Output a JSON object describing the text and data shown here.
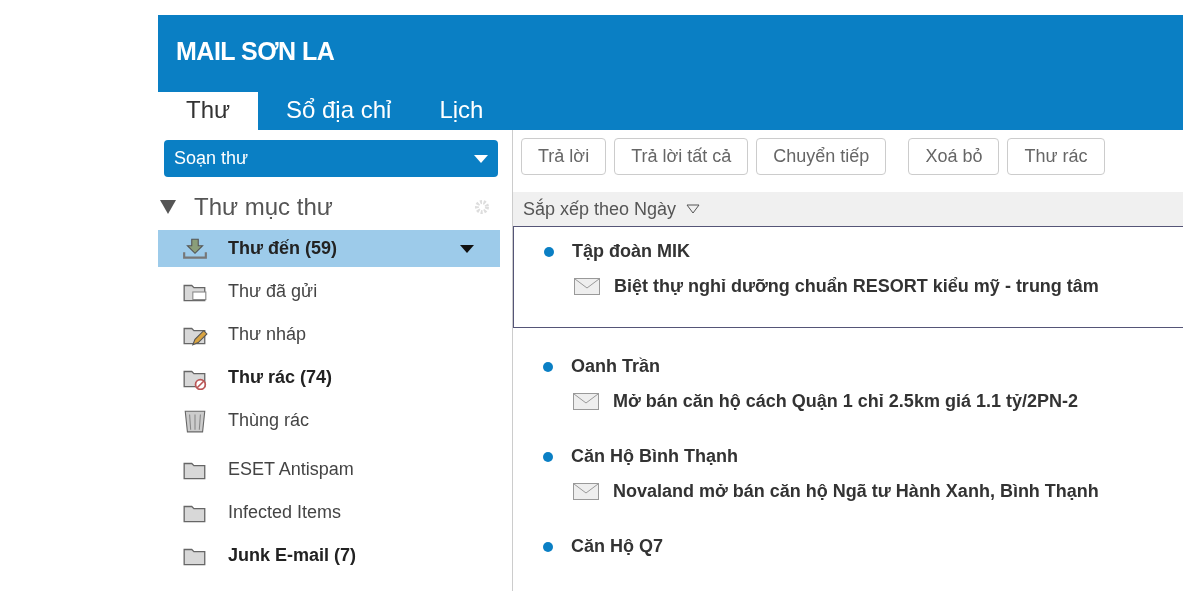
{
  "header": {
    "title": "MAIL SƠN LA"
  },
  "tabs": [
    {
      "label": "Thư",
      "selected": true
    },
    {
      "label": "Sổ địa chỉ",
      "selected": false
    },
    {
      "label": "Lịch",
      "selected": false
    }
  ],
  "compose": {
    "label": "Soạn thư"
  },
  "toolbar": [
    "Trả lời",
    "Trả lời tất cả",
    "Chuyển tiếp",
    "Xoá bỏ",
    "Thư rác"
  ],
  "folders": {
    "title": "Thư mục thư",
    "expanded": true,
    "items": [
      {
        "kind": "inbox",
        "label": "Thư đến (59)",
        "unread": true,
        "selected": true
      },
      {
        "kind": "sent",
        "label": "Thư đã gửi",
        "unread": false,
        "selected": false
      },
      {
        "kind": "drafts",
        "label": "Thư nháp",
        "unread": false,
        "selected": false
      },
      {
        "kind": "spam",
        "label": "Thư rác (74)",
        "unread": true,
        "selected": false
      },
      {
        "kind": "trash",
        "label": "Thùng rác",
        "unread": false,
        "selected": false
      },
      {
        "kind": "folder",
        "label": "ESET Antispam",
        "unread": false,
        "selected": false
      },
      {
        "kind": "folder",
        "label": "Infected Items",
        "unread": false,
        "selected": false
      },
      {
        "kind": "folder",
        "label": "Junk E-mail (7)",
        "unread": true,
        "selected": false
      }
    ]
  },
  "sort": {
    "label": "Sắp xếp theo Ngày"
  },
  "messages": [
    {
      "sender": "Tập đoàn MIK",
      "subject": "Biệt thự nghỉ dưỡng chuẩn RESORT kiểu mỹ - trung tâm",
      "unread": true,
      "selected": true
    },
    {
      "sender": "Oanh Trần",
      "subject": "Mở bán căn hộ cách Quận 1 chỉ 2.5km giá 1.1 tỷ/2PN-2",
      "unread": true,
      "selected": false
    },
    {
      "sender": "Căn Hộ Bình Thạnh",
      "subject": "Novaland mở bán căn hộ Ngã tư Hành Xanh, Bình Thạnh",
      "unread": true,
      "selected": false
    },
    {
      "sender": "Căn Hộ Q7",
      "unread": true,
      "selected": false
    }
  ]
}
